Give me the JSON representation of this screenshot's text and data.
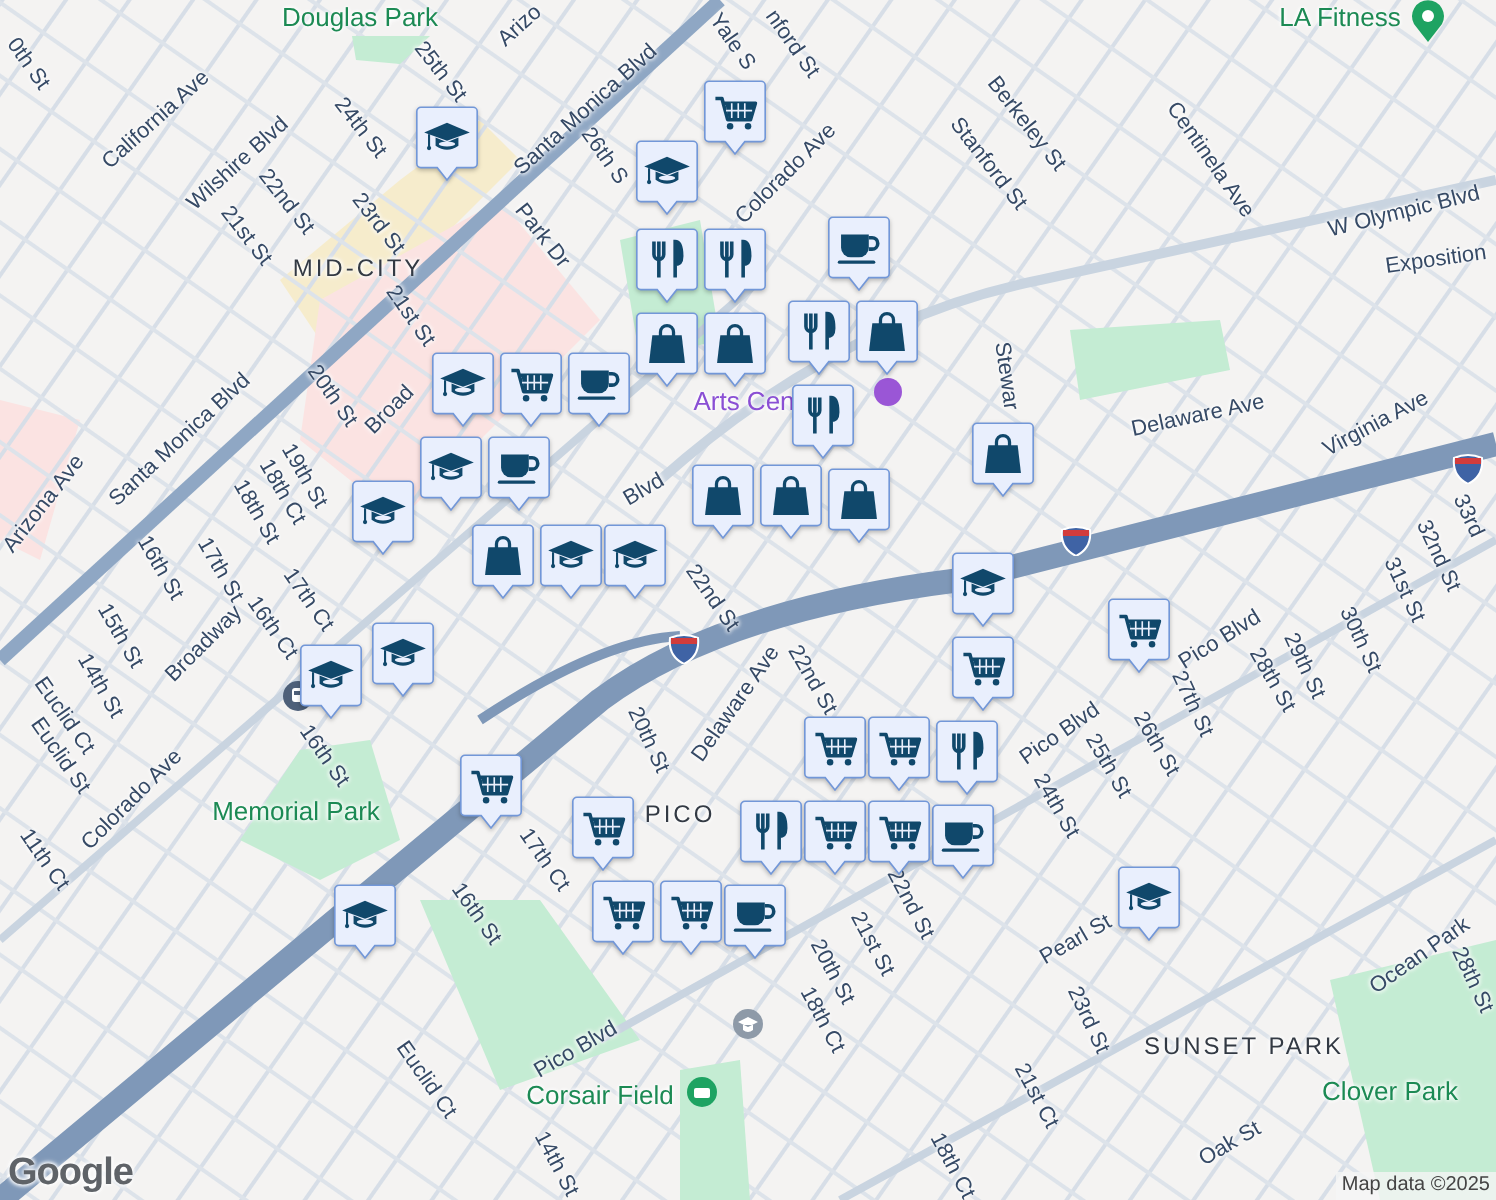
{
  "map": {
    "labels": [
      {
        "text": "Douglas Park",
        "kind": "park"
      },
      {
        "text": "LA Fitness",
        "kind": "park"
      },
      {
        "text": "0th St",
        "kind": "street"
      },
      {
        "text": "Arizo",
        "kind": "street"
      },
      {
        "text": "Yale S",
        "kind": "street"
      },
      {
        "text": "nford St",
        "kind": "street"
      },
      {
        "text": "California Ave",
        "kind": "street"
      },
      {
        "text": "25th St",
        "kind": "street"
      },
      {
        "text": "Wilshire Blvd",
        "kind": "street"
      },
      {
        "text": "24th St",
        "kind": "street"
      },
      {
        "text": "Santa Monica Blvd",
        "kind": "street"
      },
      {
        "text": "22nd St",
        "kind": "street"
      },
      {
        "text": "26th S",
        "kind": "street"
      },
      {
        "text": "Berkeley St",
        "kind": "street"
      },
      {
        "text": "Stanford St",
        "kind": "street"
      },
      {
        "text": "Centinela Ave",
        "kind": "street"
      },
      {
        "text": "21st St",
        "kind": "street"
      },
      {
        "text": "23rd St",
        "kind": "street"
      },
      {
        "text": "Park Dr",
        "kind": "street"
      },
      {
        "text": "Colorado Ave",
        "kind": "street"
      },
      {
        "text": "W Olympic Blvd",
        "kind": "street"
      },
      {
        "text": "MID-CITY",
        "kind": "district"
      },
      {
        "text": "Exposition",
        "kind": "street"
      },
      {
        "text": "21st St",
        "kind": "street"
      },
      {
        "text": "Arts Cen",
        "kind": "venue"
      },
      {
        "text": "Stewar",
        "kind": "street"
      },
      {
        "text": "20th St",
        "kind": "street"
      },
      {
        "text": "Broad",
        "kind": "street"
      },
      {
        "text": "Delaware Ave",
        "kind": "street"
      },
      {
        "text": "Virginia Ave",
        "kind": "street"
      },
      {
        "text": "19th St",
        "kind": "street"
      },
      {
        "text": "Santa Monica Blvd",
        "kind": "street"
      },
      {
        "text": "Blvd",
        "kind": "street"
      },
      {
        "text": "18th Ct",
        "kind": "street"
      },
      {
        "text": "Arizona Ave",
        "kind": "street"
      },
      {
        "text": "18th St",
        "kind": "street"
      },
      {
        "text": "33rd",
        "kind": "street"
      },
      {
        "text": "22nd St",
        "kind": "street"
      },
      {
        "text": "17th St",
        "kind": "street"
      },
      {
        "text": "32nd St",
        "kind": "street"
      },
      {
        "text": "16th St",
        "kind": "street"
      },
      {
        "text": "17th Ct",
        "kind": "street"
      },
      {
        "text": "31st St",
        "kind": "street"
      },
      {
        "text": "15th St",
        "kind": "street"
      },
      {
        "text": "16th Ct",
        "kind": "street"
      },
      {
        "text": "Broadway",
        "kind": "street"
      },
      {
        "text": "Pico Blvd",
        "kind": "street"
      },
      {
        "text": "29th St",
        "kind": "street"
      },
      {
        "text": "30th St",
        "kind": "street"
      },
      {
        "text": "14th St",
        "kind": "street"
      },
      {
        "text": "28th St",
        "kind": "street"
      },
      {
        "text": "27th St",
        "kind": "street"
      },
      {
        "text": "Euclid Ct",
        "kind": "street"
      },
      {
        "text": "Delaware Ave",
        "kind": "street"
      },
      {
        "text": "22nd St",
        "kind": "street"
      },
      {
        "text": "Euclid St",
        "kind": "street"
      },
      {
        "text": "16th St",
        "kind": "street"
      },
      {
        "text": "20th St",
        "kind": "street"
      },
      {
        "text": "26th St",
        "kind": "street"
      },
      {
        "text": "Pico Blvd",
        "kind": "street"
      },
      {
        "text": "Colorado Ave",
        "kind": "street"
      },
      {
        "text": "25th St",
        "kind": "street"
      },
      {
        "text": "24th St",
        "kind": "street"
      },
      {
        "text": "Memorial Park",
        "kind": "park"
      },
      {
        "text": "PICO",
        "kind": "district"
      },
      {
        "text": "11th Ct",
        "kind": "street"
      },
      {
        "text": "17th Ct",
        "kind": "street"
      },
      {
        "text": "22nd St",
        "kind": "street"
      },
      {
        "text": "16th St",
        "kind": "street"
      },
      {
        "text": "21st St",
        "kind": "street"
      },
      {
        "text": "Pearl St",
        "kind": "street"
      },
      {
        "text": "20th St",
        "kind": "street"
      },
      {
        "text": "Ocean Park",
        "kind": "street"
      },
      {
        "text": "28th St",
        "kind": "street"
      },
      {
        "text": "18th Ct",
        "kind": "street"
      },
      {
        "text": "23rd St",
        "kind": "street"
      },
      {
        "text": "Pico Blvd",
        "kind": "street"
      },
      {
        "text": "SUNSET PARK",
        "kind": "district"
      },
      {
        "text": "Euclid Ct",
        "kind": "street"
      },
      {
        "text": "Clover Park",
        "kind": "park"
      },
      {
        "text": "Corsair Field",
        "kind": "park"
      },
      {
        "text": "21st Ct",
        "kind": "street"
      },
      {
        "text": "Oak St",
        "kind": "street"
      },
      {
        "text": "14th St",
        "kind": "street"
      },
      {
        "text": "18th Ct",
        "kind": "street"
      }
    ],
    "markers": [
      {
        "kind": "grocery"
      },
      {
        "kind": "school"
      },
      {
        "kind": "school"
      },
      {
        "kind": "cafe"
      },
      {
        "kind": "restaurant"
      },
      {
        "kind": "restaurant"
      },
      {
        "kind": "shopping"
      },
      {
        "kind": "shopping"
      },
      {
        "kind": "shopping"
      },
      {
        "kind": "cafe"
      },
      {
        "kind": "restaurant"
      },
      {
        "kind": "grocery"
      },
      {
        "kind": "school"
      },
      {
        "kind": "cafe"
      },
      {
        "kind": "restaurant"
      },
      {
        "kind": "school"
      },
      {
        "kind": "school"
      },
      {
        "kind": "shopping"
      },
      {
        "kind": "shopping"
      },
      {
        "kind": "shopping"
      },
      {
        "kind": "shopping"
      },
      {
        "kind": "shopping"
      },
      {
        "kind": "school"
      },
      {
        "kind": "school"
      },
      {
        "kind": "school"
      },
      {
        "kind": "grocery"
      },
      {
        "kind": "school"
      },
      {
        "kind": "school"
      },
      {
        "kind": "grocery"
      },
      {
        "kind": "grocery"
      },
      {
        "kind": "grocery"
      },
      {
        "kind": "restaurant"
      },
      {
        "kind": "cafe"
      },
      {
        "kind": "grocery"
      },
      {
        "kind": "grocery"
      },
      {
        "kind": "grocery"
      },
      {
        "kind": "restaurant"
      },
      {
        "kind": "cafe"
      },
      {
        "kind": "grocery"
      },
      {
        "kind": "grocery"
      },
      {
        "kind": "grocery"
      },
      {
        "kind": "school"
      },
      {
        "kind": "school"
      }
    ]
  },
  "attribution": {
    "logo": "Google",
    "text": "Map data ©2025"
  }
}
